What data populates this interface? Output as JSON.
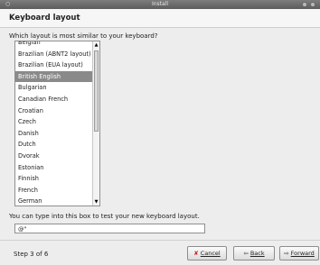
{
  "window": {
    "title": "Install",
    "icon": "app-menu-icon"
  },
  "page": {
    "heading": "Keyboard layout",
    "prompt": "Which layout is most similar to your keyboard?"
  },
  "layouts": {
    "items": [
      "Belgian",
      "Brazilian (ABNT2 layout)",
      "Brazilian (EUA layout)",
      "British English",
      "Bulgarian",
      "Canadian French",
      "Croatian",
      "Czech",
      "Danish",
      "Dutch",
      "Dvorak",
      "Estonian",
      "Finnish",
      "French",
      "German"
    ],
    "selected": "British English"
  },
  "test": {
    "label": "You can type into this box to test your new keyboard layout.",
    "value": "@\""
  },
  "footer": {
    "step": "Step 3 of 6",
    "cancel_label": "Cancel",
    "back_label": "Back",
    "forward_label": "Forward"
  },
  "icons": {
    "cancel": "cancel-x-icon",
    "back": "arrow-left-icon",
    "forward": "arrow-right-icon"
  }
}
